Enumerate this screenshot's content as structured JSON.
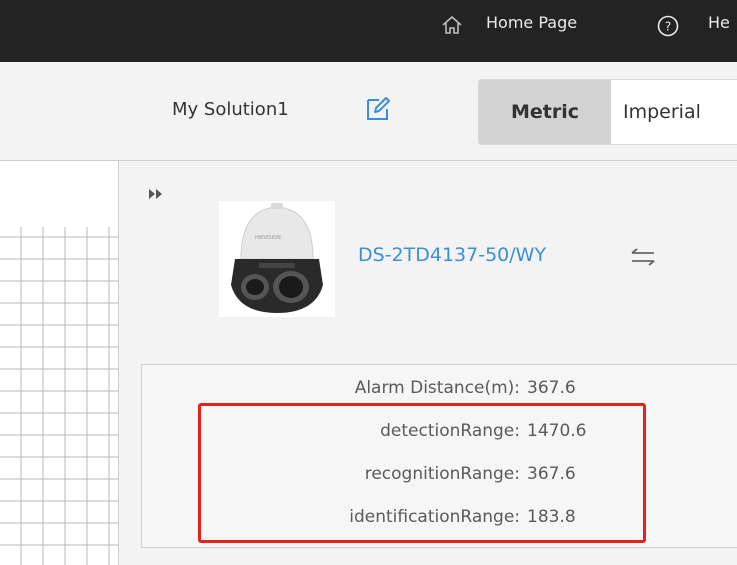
{
  "topbar": {
    "home_label": "Home Page",
    "help_label": "He",
    "icons": [
      "home-icon",
      "help-icon"
    ]
  },
  "toolbar": {
    "solution_name": "My Solution1",
    "edit_icon": "edit-icon",
    "units": {
      "metric": "Metric",
      "imperial": "Imperial",
      "selected": "Metric"
    }
  },
  "device": {
    "model": "DS-2TD4137-50/WY",
    "swap_icon": "swap-icon",
    "expand_icon": "expand-icon"
  },
  "specs": [
    {
      "label": "Alarm Distance(m):",
      "value": "367.6"
    },
    {
      "label": "detectionRange:",
      "value": "1470.6"
    },
    {
      "label": "recognitionRange:",
      "value": "367.6"
    },
    {
      "label": "identificationRange:",
      "value": "183.8"
    }
  ],
  "colors": {
    "topbar_bg": "#232323",
    "accent_blue": "#3b8fd9",
    "highlight_red": "#e8221b",
    "panel_bg": "#f3f3f3"
  }
}
